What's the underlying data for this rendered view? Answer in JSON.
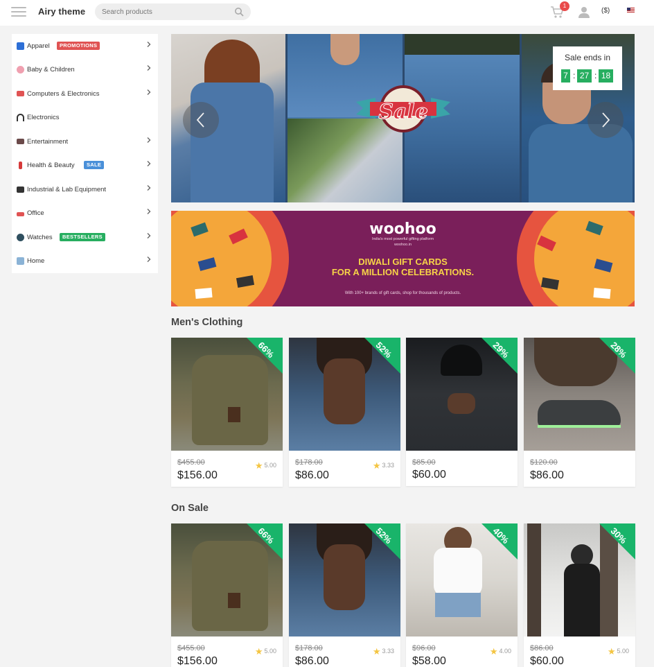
{
  "header": {
    "logo": "Airy theme",
    "search_placeholder": "Search products",
    "cart_count": "1",
    "currency": "($)"
  },
  "sidebar": {
    "items": [
      {
        "label": "Apparel",
        "badge": "PROMOTIONS",
        "badge_color": "#e05353",
        "icon": "shirt-icon",
        "has_children": true
      },
      {
        "label": "Baby & Children",
        "badge": "",
        "icon": "baby-icon",
        "has_children": true
      },
      {
        "label": "Computers & Electronics",
        "badge": "",
        "icon": "monitor-icon",
        "has_children": true
      },
      {
        "label": "Electronics",
        "badge": "",
        "icon": "headphones-icon",
        "has_children": false
      },
      {
        "label": "Entertainment",
        "badge": "",
        "icon": "camera-icon",
        "has_children": true
      },
      {
        "label": "Health & Beauty",
        "badge": "SALE",
        "badge_color": "#4a90d9",
        "icon": "lipstick-icon",
        "has_children": true
      },
      {
        "label": "Industrial & Lab Equipment",
        "badge": "",
        "icon": "clapper-icon",
        "has_children": true
      },
      {
        "label": "Office",
        "badge": "",
        "icon": "office-icon",
        "has_children": true
      },
      {
        "label": "Watches",
        "badge": "BESTSELLERS",
        "badge_color": "#27ae60",
        "icon": "watch-icon",
        "has_children": true
      },
      {
        "label": "Home",
        "badge": "",
        "icon": "house-icon",
        "has_children": true
      }
    ]
  },
  "hero": {
    "sale_text": "Sale",
    "countdown_title": "Sale ends in",
    "countdown": [
      "7",
      "27",
      "18"
    ]
  },
  "banner": {
    "brand": "woohoo",
    "tagline": "India's most powerful gifting platform",
    "site": "woohoo.in",
    "headline_1": "DIWALI GIFT CARDS",
    "headline_2": "FOR A MILLION CELEBRATIONS.",
    "subline": "With 100+ brands of gift cards, shop for thousands of products."
  },
  "sections": [
    {
      "title": "Men's Clothing",
      "products": [
        {
          "discount": "66%",
          "old_price": "$455.00",
          "price": "$156.00",
          "rating": "5.00",
          "image": "backpack"
        },
        {
          "discount": "52%",
          "old_price": "$178.00",
          "price": "$86.00",
          "rating": "3.33",
          "image": "denim-vest"
        },
        {
          "discount": "29%",
          "old_price": "$85.00",
          "price": "$60.00",
          "rating": "",
          "image": "black-shirt"
        },
        {
          "discount": "28%",
          "old_price": "$120.00",
          "price": "$86.00",
          "rating": "",
          "image": "sneakers"
        }
      ]
    },
    {
      "title": "On Sale",
      "products": [
        {
          "discount": "66%",
          "old_price": "$455.00",
          "price": "$156.00",
          "rating": "5.00",
          "image": "backpack"
        },
        {
          "discount": "52%",
          "old_price": "$178.00",
          "price": "$86.00",
          "rating": "3.33",
          "image": "denim-vest"
        },
        {
          "discount": "40%",
          "old_price": "$96.00",
          "price": "$58.00",
          "rating": "4.00",
          "image": "denim-shorts"
        },
        {
          "discount": "30%",
          "old_price": "$86.00",
          "price": "$60.00",
          "rating": "5.00",
          "image": "winter-coat"
        }
      ]
    }
  ]
}
